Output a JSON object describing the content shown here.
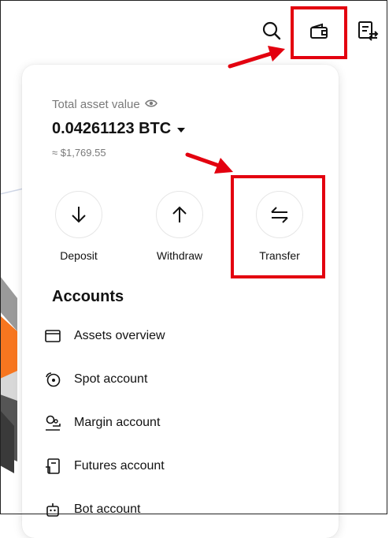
{
  "header": {
    "icons": [
      "search-icon",
      "wallet-icon",
      "orders-icon"
    ]
  },
  "overview": {
    "total_label": "Total asset value",
    "balance": "0.04261123 BTC",
    "fiat_value": "≈ $1,769.55"
  },
  "actions": [
    {
      "label": "Deposit",
      "icon": "arrow-down-icon"
    },
    {
      "label": "Withdraw",
      "icon": "arrow-up-icon"
    },
    {
      "label": "Transfer",
      "icon": "transfer-icon"
    }
  ],
  "accounts": {
    "title": "Accounts",
    "items": [
      {
        "label": "Assets overview",
        "icon": "wallet-outline-icon"
      },
      {
        "label": "Spot account",
        "icon": "spot-icon"
      },
      {
        "label": "Margin account",
        "icon": "margin-icon"
      },
      {
        "label": "Futures account",
        "icon": "futures-icon"
      },
      {
        "label": "Bot account",
        "icon": "bot-icon"
      }
    ]
  },
  "colors": {
    "annotation_red": "#e3000f",
    "accent_orange": "#f7761f",
    "text_primary": "#121212",
    "text_secondary": "#7a7a7a"
  }
}
